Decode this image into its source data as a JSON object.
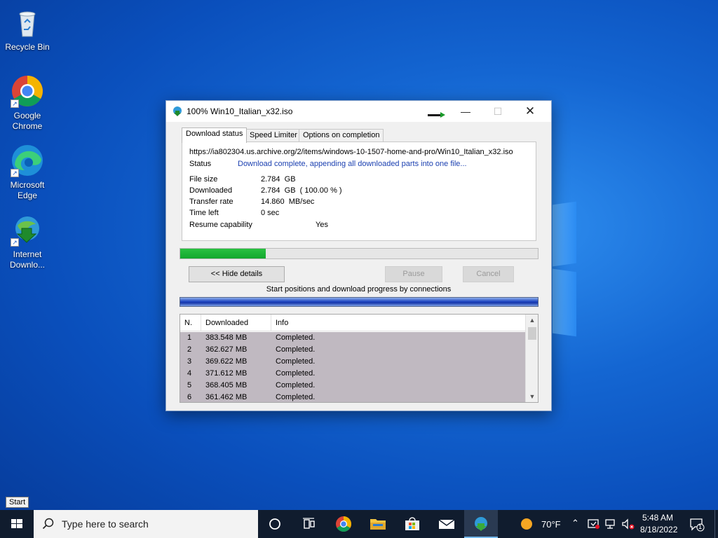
{
  "desktop": {
    "icons": [
      {
        "label": "Recycle Bin",
        "icon": "recycle-bin-icon"
      },
      {
        "label": "Google Chrome",
        "icon": "chrome-icon"
      },
      {
        "label": "Microsoft Edge",
        "icon": "edge-icon"
      },
      {
        "label": "Internet Downlo...",
        "icon": "idm-icon"
      }
    ]
  },
  "window": {
    "title": "100% Win10_Italian_x32.iso",
    "tabs": [
      "Download status",
      "Speed Limiter",
      "Options on completion"
    ],
    "url": "https://ia802304.us.archive.org/2/items/windows-10-1507-home-and-pro/Win10_Italian_x32.iso",
    "status_label": "Status",
    "status_value": "Download complete, appending all downloaded parts into one file...",
    "file_size_label": "File size",
    "file_size": "2.784  GB",
    "downloaded_label": "Downloaded",
    "downloaded": "2.784  GB  ( 100.00 % )",
    "transfer_rate_label": "Transfer rate",
    "transfer_rate": "14.860  MB/sec",
    "time_left_label": "Time left",
    "time_left": "0 sec",
    "resume_label": "Resume capability",
    "resume": "Yes",
    "progress_fraction": 0.24,
    "hide_details_label": "<< Hide details",
    "pause_label": "Pause",
    "cancel_label": "Cancel",
    "connections_caption": "Start positions and download progress by connections",
    "columns": [
      "N.",
      "Downloaded",
      "Info"
    ],
    "connections": [
      {
        "n": "1",
        "downloaded": "383.548  MB",
        "info": "Completed."
      },
      {
        "n": "2",
        "downloaded": "362.627  MB",
        "info": "Completed."
      },
      {
        "n": "3",
        "downloaded": "369.622  MB",
        "info": "Completed."
      },
      {
        "n": "4",
        "downloaded": "371.612  MB",
        "info": "Completed."
      },
      {
        "n": "5",
        "downloaded": "368.405  MB",
        "info": "Completed."
      },
      {
        "n": "6",
        "downloaded": "361.462  MB",
        "info": "Completed."
      }
    ]
  },
  "taskbar": {
    "start_tooltip": "Start",
    "search_placeholder": "Type here to search",
    "weather": "70°F",
    "time": "5:48 AM",
    "date": "8/18/2022",
    "notification_count": "1"
  }
}
